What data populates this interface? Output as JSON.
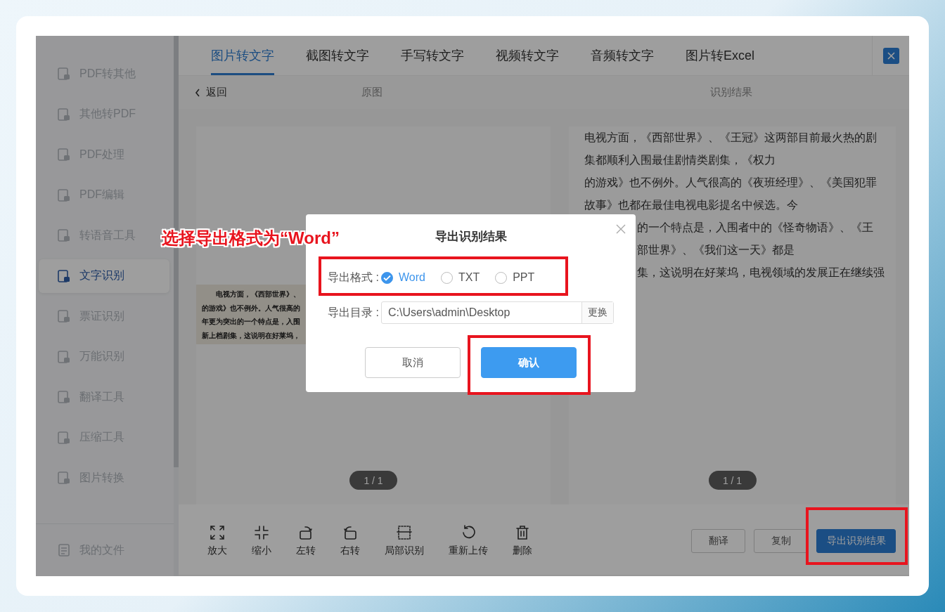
{
  "sidebar": {
    "items": [
      {
        "label": "PDF转其他",
        "selected": false
      },
      {
        "label": "其他转PDF",
        "selected": false
      },
      {
        "label": "PDF处理",
        "selected": false
      },
      {
        "label": "PDF编辑",
        "selected": false
      },
      {
        "label": "转语音工具",
        "selected": false
      },
      {
        "label": "文字识别",
        "selected": true
      },
      {
        "label": "票证识别",
        "selected": false
      },
      {
        "label": "万能识别",
        "selected": false
      },
      {
        "label": "翻译工具",
        "selected": false
      },
      {
        "label": "压缩工具",
        "selected": false
      },
      {
        "label": "图片转换",
        "selected": false
      }
    ],
    "footer_item": "我的文件"
  },
  "tabs": [
    {
      "label": "图片转文字",
      "selected": true
    },
    {
      "label": "截图转文字",
      "selected": false
    },
    {
      "label": "手写转文字",
      "selected": false
    },
    {
      "label": "视频转文字",
      "selected": false
    },
    {
      "label": "音频转文字",
      "selected": false
    },
    {
      "label": "图片转Excel",
      "selected": false
    }
  ],
  "subheader": {
    "back": "返回",
    "original_title": "原图",
    "result_title": "识别结果"
  },
  "original_panel": {
    "scan_lines": [
      "电视方面，《西部世界》、",
      "的游戏》也不例外。人气很高的",
      "年更为突出的一个特点是，入围",
      "新上档剧集，这说明在好莱坞，"
    ],
    "page_indicator": "1 / 1"
  },
  "result_panel": {
    "lines": [
      "电视方面，《西部世界》、《王冠》这两部目前最火热的剧",
      "集都顺利入围最佳剧情类剧集，《权力",
      "的游戏》也不例外。人气很高的《夜班经理》、《美国犯罪",
      "故事》也都在最佳电视电影提名中候选。今"
    ],
    "lines_behind_dialog": [
      "的一个特点是，入围者中的《怪奇物语》、《王",
      "部世界》、《我们这一天》都是",
      "集，这说明在好莱坞，电视领域的发展正在继续强"
    ],
    "page_indicator": "1 / 1"
  },
  "toolbar": {
    "tools": [
      {
        "label": "放大",
        "kind": "expand"
      },
      {
        "label": "缩小",
        "kind": "shrink"
      },
      {
        "label": "左转",
        "kind": "rotate-left"
      },
      {
        "label": "右转",
        "kind": "rotate-right"
      },
      {
        "label": "局部识别",
        "kind": "crop"
      },
      {
        "label": "重新上传",
        "kind": "reload"
      },
      {
        "label": "删除",
        "kind": "delete"
      }
    ]
  },
  "actions": [
    {
      "label": "翻译",
      "primary": false
    },
    {
      "label": "复制",
      "primary": false
    },
    {
      "label": "导出识别结果",
      "primary": true
    }
  ],
  "dialog": {
    "title": "导出识别结果",
    "format_label": "导出格式 :",
    "formats": [
      {
        "label": "Word",
        "selected": true
      },
      {
        "label": "TXT",
        "selected": false
      },
      {
        "label": "PPT",
        "selected": false
      }
    ],
    "dir_label": "导出目录 :",
    "dir_value": "C:\\Users\\admin\\Desktop",
    "change_button": "更换",
    "cancel": "取消",
    "confirm": "确认"
  },
  "annotation": "选择导出格式为“Word”"
}
